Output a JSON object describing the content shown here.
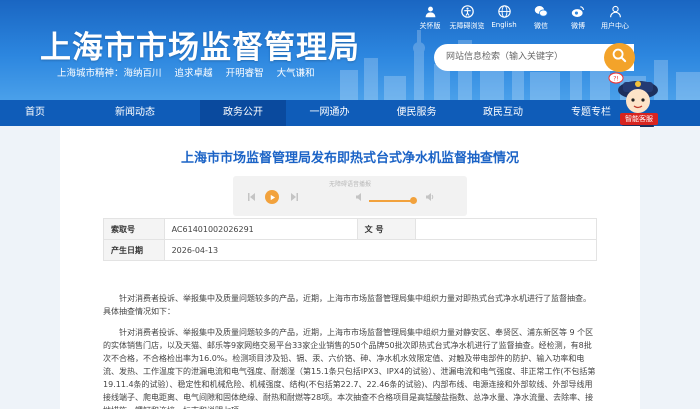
{
  "header": {
    "site_title": "上海市市场监督管理局",
    "slogan": [
      "上海城市精神：海纳百川",
      "追求卓越",
      "开明睿智",
      "大气谦和"
    ],
    "search_placeholder": "网站信息检索（输入关键字）",
    "toplinks": [
      {
        "label": "关怀版",
        "icon": "care-icon"
      },
      {
        "label": "无障碍浏览",
        "icon": "accessibility-icon"
      },
      {
        "label": "English",
        "icon": "globe-icon"
      },
      {
        "label": "微信",
        "icon": "wechat-icon"
      },
      {
        "label": "微博",
        "icon": "weibo-icon"
      },
      {
        "label": "用户中心",
        "icon": "user-icon"
      }
    ],
    "mascot_label": "智能客服"
  },
  "nav": {
    "items": [
      "首页",
      "新闻动态",
      "政务公开",
      "一网通办",
      "便民服务",
      "政民互动",
      "专题专栏"
    ],
    "active": "政务公开"
  },
  "article": {
    "title": "上海市市场监督管理局发布即热式台式净水机监督抽查情况",
    "player_caption": "无障碍语音播报",
    "meta": {
      "index_label": "索取号",
      "index_value": "AC61401002026291",
      "doc_label": "文  号",
      "doc_value": "",
      "date_label": "产生日期",
      "date_value": "2026-04-13"
    },
    "paragraphs": [
      "针对消费者投诉、举报集中及质量问题较多的产品，近期，上海市市场监督管理局集中组织力量对即热式台式净水机进行了监督抽查。具体抽查情况如下：",
      "针对消费者投诉、举报集中及质量问题较多的产品，近期，上海市市场监督管理局集中组织力量对静安区、奉贤区、浦东新区等 9 个区的实体销售门店，以及天猫、邮乐等9家网络交易平台33家企业销售的50个品牌50批次即热式台式净水机进行了监督抽查。经检测，有8批次不合格，不合格检出率为16.0%。检测项目涉及铅、镉、汞、六价铬、砷、净水机水效限定值、对触及带电部件的防护、输入功率和电流、发热、工作温度下的泄漏电流和电气强度、耐潮湿（第15.1条只包括IPX3、IPX4的试验）、泄漏电流和电气强度、非正常工作(不包括第19.11.4条的试验）、稳定性和机械危险、机械强度、结构(不包括第22.7、22.46条的试验)、内部布线、电源连接和外部软线、外部导线用接线端子、爬电距离、电气间隙和固体绝缘、耐热和耐燃等28项。本次抽查不合格项目是高锰酸盐指数、总净水量、净水流量、去除率、接地措施、螺钉和连接、标志和说明七项。"
    ]
  },
  "colors": {
    "header_blue": "#1a66c2",
    "nav_blue": "#0f5cb8",
    "title_blue": "#1b63c6",
    "accent_orange": "#f3a32a"
  }
}
